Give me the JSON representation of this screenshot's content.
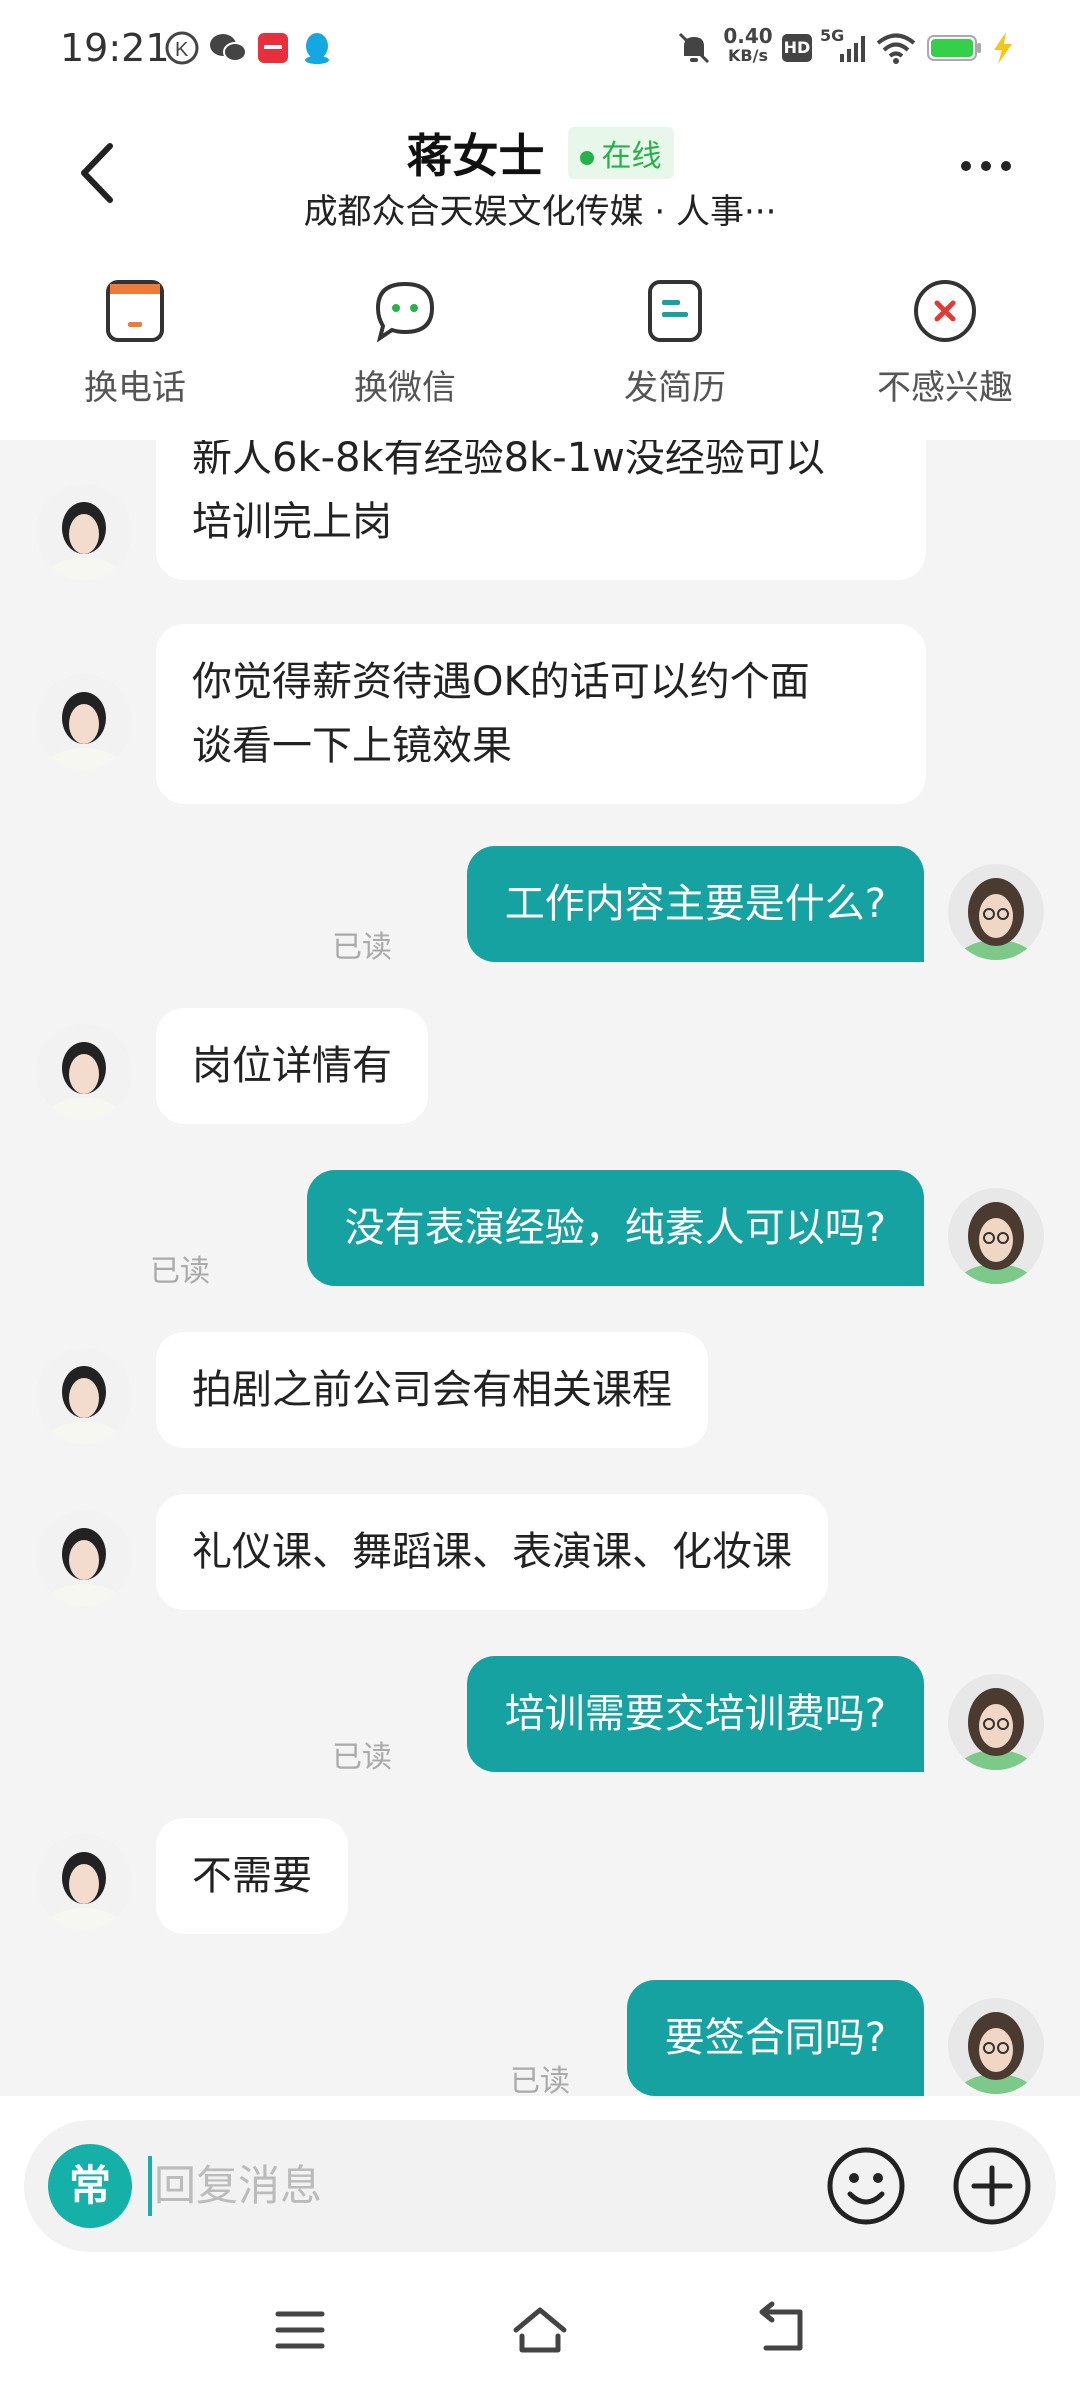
{
  "status_bar": {
    "time": "19:21",
    "net_speed_value": "0.40",
    "net_speed_unit": "KB/s",
    "hd": "HD",
    "net_type": "5G"
  },
  "header": {
    "name": "蒋女士",
    "online": "在线",
    "company": "成都众合天娱文化传媒 · 人事···"
  },
  "actions": [
    {
      "label": "换电话",
      "icon": "phone-swap-icon"
    },
    {
      "label": "换微信",
      "icon": "wechat-icon"
    },
    {
      "label": "发简历",
      "icon": "resume-icon"
    },
    {
      "label": "不感兴趣",
      "icon": "not-interested-icon"
    }
  ],
  "messages": [
    {
      "from": "them",
      "text_line1": "新人6k-8k有经验8k-1w没经验可以",
      "text_line2": "培训完上岗"
    },
    {
      "from": "them",
      "text_line1": "你觉得薪资待遇OK的话可以约个面",
      "text_line2": "谈看一下上镜效果"
    },
    {
      "from": "me",
      "text": "工作内容主要是什么?",
      "status": "已读"
    },
    {
      "from": "them",
      "text": "岗位详情有"
    },
    {
      "from": "me",
      "text": "没有表演经验，纯素人可以吗?",
      "status": "已读"
    },
    {
      "from": "them",
      "text": "拍剧之前公司会有相关课程"
    },
    {
      "from": "them",
      "text": "礼仪课、舞蹈课、表演课、化妆课"
    },
    {
      "from": "me",
      "text": "培训需要交培训费吗?",
      "status": "已读"
    },
    {
      "from": "them",
      "text": "不需要"
    },
    {
      "from": "me",
      "text": "要签合同吗?",
      "status": "已读"
    }
  ],
  "input": {
    "quick_label": "常",
    "placeholder": "回复消息"
  },
  "colors": {
    "accent": "#15a2a0",
    "online": "#27b14a",
    "phone_icon": "#f07a3a",
    "reject_icon": "#e53935"
  }
}
